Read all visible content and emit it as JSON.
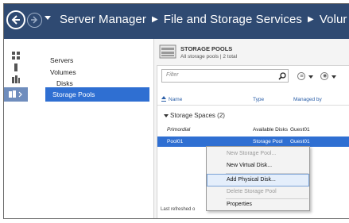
{
  "window": {
    "breadcrumb": [
      "Server Manager",
      "File and Storage Services",
      "Volur"
    ]
  },
  "sidebar": {
    "items": [
      {
        "label": "Servers"
      },
      {
        "label": "Volumes"
      },
      {
        "label": "Disks"
      },
      {
        "label": "Storage Pools",
        "selected": true
      }
    ]
  },
  "pools": {
    "title": "STORAGE POOLS",
    "subtitle": "All storage pools | 2 total",
    "filter_placeholder": "Filter",
    "columns": [
      "Name",
      "Type",
      "Managed by"
    ],
    "group_label": "Storage Spaces (2)",
    "rows": [
      {
        "name": "Primordial",
        "type": "Available Disks",
        "managed_by": "Guest01",
        "selected": false
      },
      {
        "name": "Pool01",
        "type": "Storage Pool",
        "managed_by": "Guest01",
        "selected": true
      }
    ],
    "status": "Last refreshed o"
  },
  "context_menu": {
    "items": [
      {
        "label": "New Storage Pool...",
        "enabled": false
      },
      {
        "label": "New Virtual Disk...",
        "enabled": true
      },
      {
        "label": "Add Physical Disk...",
        "enabled": true,
        "highlighted": true
      },
      {
        "label": "Delete Storage Pool",
        "enabled": false
      },
      {
        "label": "Properties",
        "enabled": true
      }
    ]
  },
  "colors": {
    "titlebar": "#2f4a72",
    "selection": "#2f6fd2",
    "header_text": "#2b5fa8"
  }
}
